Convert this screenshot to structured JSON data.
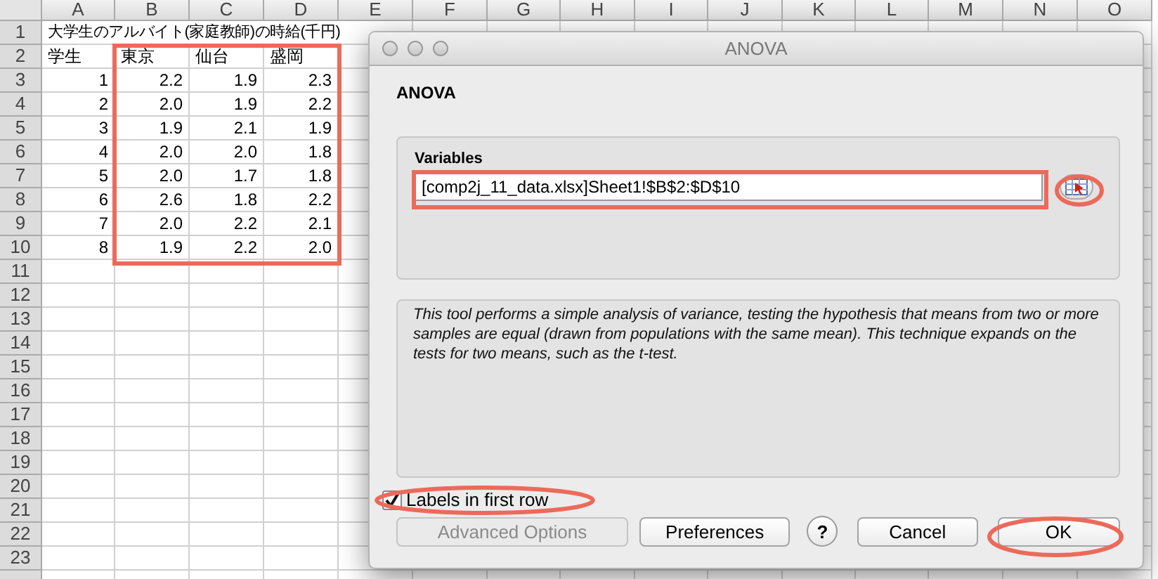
{
  "spreadsheet": {
    "columns": [
      "A",
      "B",
      "C",
      "D",
      "E",
      "F",
      "G",
      "H",
      "I",
      "J",
      "K",
      "L",
      "M",
      "N",
      "O"
    ],
    "rows": [
      {
        "number": "1",
        "kind": "title",
        "cells": {
          "A": "大学生のアルバイト(家庭教師)の時給(千円)"
        }
      },
      {
        "number": "2",
        "kind": "header",
        "cells": {
          "A": "学生",
          "B": "東京",
          "C": "仙台",
          "D": "盛岡"
        }
      },
      {
        "number": "3",
        "kind": "data",
        "cells": {
          "A": "1",
          "B": "2.2",
          "C": "1.9",
          "D": "2.3"
        }
      },
      {
        "number": "4",
        "kind": "data",
        "cells": {
          "A": "2",
          "B": "2.0",
          "C": "1.9",
          "D": "2.2"
        }
      },
      {
        "number": "5",
        "kind": "data",
        "cells": {
          "A": "3",
          "B": "1.9",
          "C": "2.1",
          "D": "1.9"
        }
      },
      {
        "number": "6",
        "kind": "data",
        "cells": {
          "A": "4",
          "B": "2.0",
          "C": "2.0",
          "D": "1.8"
        }
      },
      {
        "number": "7",
        "kind": "data",
        "cells": {
          "A": "5",
          "B": "2.0",
          "C": "1.7",
          "D": "1.8"
        }
      },
      {
        "number": "8",
        "kind": "data",
        "cells": {
          "A": "6",
          "B": "2.6",
          "C": "1.8",
          "D": "2.2"
        }
      },
      {
        "number": "9",
        "kind": "data",
        "cells": {
          "A": "7",
          "B": "2.0",
          "C": "2.2",
          "D": "2.1"
        }
      },
      {
        "number": "10",
        "kind": "data",
        "cells": {
          "A": "8",
          "B": "1.9",
          "C": "2.2",
          "D": "2.0"
        }
      },
      {
        "number": "11",
        "kind": "data",
        "cells": {}
      },
      {
        "number": "12",
        "kind": "data",
        "cells": {}
      },
      {
        "number": "13",
        "kind": "data",
        "cells": {}
      },
      {
        "number": "14",
        "kind": "data",
        "cells": {}
      },
      {
        "number": "15",
        "kind": "data",
        "cells": {}
      },
      {
        "number": "16",
        "kind": "data",
        "cells": {}
      },
      {
        "number": "17",
        "kind": "data",
        "cells": {}
      },
      {
        "number": "18",
        "kind": "data",
        "cells": {}
      },
      {
        "number": "19",
        "kind": "data",
        "cells": {}
      },
      {
        "number": "20",
        "kind": "data",
        "cells": {}
      },
      {
        "number": "21",
        "kind": "data",
        "cells": {}
      },
      {
        "number": "22",
        "kind": "data",
        "cells": {}
      },
      {
        "number": "23",
        "kind": "data",
        "cells": {}
      }
    ]
  },
  "dialog": {
    "title": "ANOVA",
    "heading": "ANOVA",
    "variables": {
      "label": "Variables",
      "value": "[comp2j_11_data.xlsx]Sheet1!$B$2:$D$10"
    },
    "description": "This tool performs a simple analysis of variance, testing the hypothesis that means from two or more samples are equal (drawn from populations with the same mean). This technique expands on the tests for two means, such as the t-test.",
    "labels_checkbox": {
      "label": "Labels in first row",
      "checked": true
    },
    "buttons": [
      {
        "kind": "button",
        "label": "Advanced Options",
        "disabled": true
      },
      {
        "kind": "button",
        "label": "Preferences",
        "disabled": false
      },
      {
        "kind": "help",
        "label": "?",
        "disabled": false
      },
      {
        "kind": "button",
        "label": "Cancel",
        "disabled": false
      },
      {
        "kind": "button",
        "label": "OK",
        "disabled": false
      }
    ]
  }
}
